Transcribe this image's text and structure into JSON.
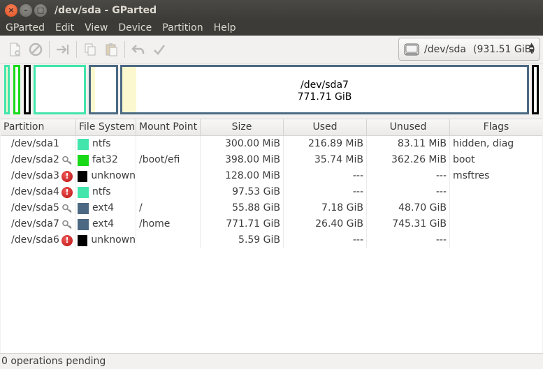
{
  "window": {
    "title": "/dev/sda - GParted"
  },
  "menu": [
    "GParted",
    "Edit",
    "View",
    "Device",
    "Partition",
    "Help"
  ],
  "device_selector": {
    "device": "/dev/sda",
    "size": "(931.51 GiB)"
  },
  "disk_map": {
    "selected_label": "/dev/sda7",
    "selected_size": "771.71 GiB"
  },
  "table": {
    "headers": [
      "Partition",
      "File System",
      "Mount Point",
      "Size",
      "Used",
      "Unused",
      "Flags"
    ],
    "rows": [
      {
        "partition": "/dev/sda1",
        "status": "none",
        "fs": "ntfs",
        "fs_color": "#42e5ac",
        "mount": "",
        "size": "300.00 MiB",
        "used": "216.89 MiB",
        "unused": "83.11 MiB",
        "flags": "hidden, diag"
      },
      {
        "partition": "/dev/sda2",
        "status": "key",
        "fs": "fat32",
        "fs_color": "#18d918",
        "mount": "/boot/efi",
        "size": "398.00 MiB",
        "used": "35.74 MiB",
        "unused": "362.26 MiB",
        "flags": "boot"
      },
      {
        "partition": "/dev/sda3",
        "status": "error",
        "fs": "unknown",
        "fs_color": "#000000",
        "mount": "",
        "size": "128.00 MiB",
        "used": "---",
        "unused": "---",
        "flags": "msftres"
      },
      {
        "partition": "/dev/sda4",
        "status": "error",
        "fs": "ntfs",
        "fs_color": "#42e5ac",
        "mount": "",
        "size": "97.53 GiB",
        "used": "---",
        "unused": "---",
        "flags": ""
      },
      {
        "partition": "/dev/sda5",
        "status": "key",
        "fs": "ext4",
        "fs_color": "#4b6983",
        "mount": "/",
        "size": "55.88 GiB",
        "used": "7.18 GiB",
        "unused": "48.70 GiB",
        "flags": ""
      },
      {
        "partition": "/dev/sda7",
        "status": "key",
        "fs": "ext4",
        "fs_color": "#4b6983",
        "mount": "/home",
        "size": "771.71 GiB",
        "used": "26.40 GiB",
        "unused": "745.31 GiB",
        "flags": ""
      },
      {
        "partition": "/dev/sda6",
        "status": "error",
        "fs": "unknown",
        "fs_color": "#000000",
        "mount": "",
        "size": "5.59 GiB",
        "used": "---",
        "unused": "---",
        "flags": ""
      }
    ]
  },
  "status_bar": {
    "text": "0 operations pending"
  }
}
